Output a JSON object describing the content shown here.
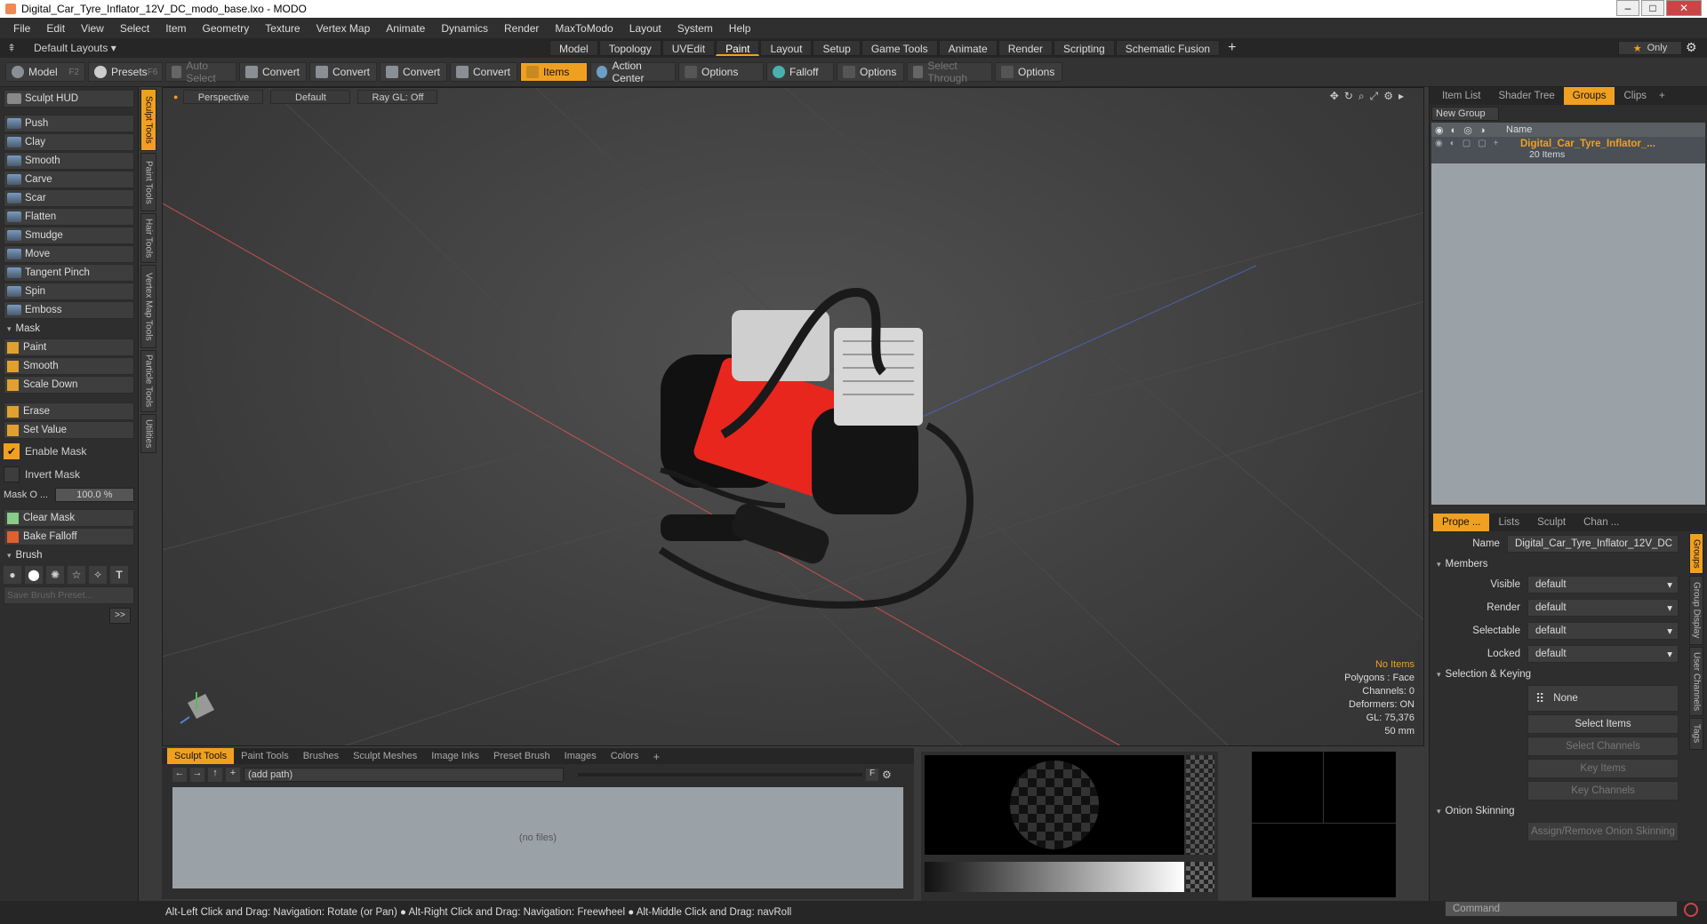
{
  "window": {
    "title": "Digital_Car_Tyre_Inflator_12V_DC_modo_base.lxo - MODO"
  },
  "menu": [
    "File",
    "Edit",
    "View",
    "Select",
    "Item",
    "Geometry",
    "Texture",
    "Vertex Map",
    "Animate",
    "Dynamics",
    "Render",
    "MaxToModo",
    "Layout",
    "System",
    "Help"
  ],
  "layoutbar": {
    "layout_select": "Default Layouts ▾",
    "tabs": [
      "Model",
      "Topology",
      "UVEdit",
      "Paint",
      "Layout",
      "Setup",
      "Game Tools",
      "Animate",
      "Render",
      "Scripting",
      "Schematic Fusion"
    ],
    "active_tab": "Paint",
    "only_label": "Only"
  },
  "toolbar": {
    "model": "Model",
    "model_key": "F2",
    "presets": "Presets",
    "presets_key": "F6",
    "auto_select": "Auto Select",
    "convert1": "Convert",
    "convert2": "Convert",
    "convert3": "Convert",
    "convert4": "Convert",
    "items": "Items",
    "action_center": "Action Center",
    "options1": "Options",
    "falloff": "Falloff",
    "options2": "Options",
    "select_through": "Select Through",
    "options3": "Options"
  },
  "left": {
    "hud": "Sculpt HUD",
    "tools": [
      "Push",
      "Clay",
      "Smooth",
      "Carve",
      "Scar",
      "Flatten",
      "Smudge",
      "Move",
      "Tangent Pinch",
      "Spin",
      "Emboss"
    ],
    "mask_section": "Mask",
    "mask_tools": [
      "Paint",
      "Smooth",
      "Scale Down"
    ],
    "erase": "Erase",
    "set_value": "Set Value",
    "enable_mask": "Enable Mask",
    "invert_mask": "Invert Mask",
    "mask_opacity_label": "Mask O ...",
    "mask_opacity": "100.0 %",
    "clear_mask": "Clear Mask",
    "bake_falloff": "Bake Falloff",
    "brush_section": "Brush",
    "save_brush": "Save Brush Preset...",
    "more": ">>"
  },
  "vtabs": [
    "Sculpt Tools",
    "Paint Tools",
    "Hair Tools",
    "Vertex Map Tools",
    "Particle Tools",
    "Utilities"
  ],
  "viewport": {
    "view": "Perspective",
    "shading": "Default",
    "raygl": "Ray GL: Off",
    "stats": {
      "items": "No Items",
      "polygons": "Polygons : Face",
      "channels": "Channels: 0",
      "deformers": "Deformers: ON",
      "gl": "GL: 75,376",
      "size": "50 mm"
    }
  },
  "bottom": {
    "tabs": [
      "Sculpt Tools",
      "Paint Tools",
      "Brushes",
      "Sculpt Meshes",
      "Image Inks",
      "Preset Brush",
      "Images",
      "Colors"
    ],
    "path": "(add path)",
    "no_files": "(no files)"
  },
  "right": {
    "top_tabs": [
      "Item List",
      "Shader Tree",
      "Groups",
      "Clips"
    ],
    "active_top": "Groups",
    "new_group": "New Group",
    "col_name": "Name",
    "group_name": "Digital_Car_Tyre_Inflator_...",
    "group_count": "20 Items",
    "prop_tabs": [
      "Prope ...",
      "Lists",
      "Sculpt",
      "Chan ..."
    ],
    "name_label": "Name",
    "name_value": "Digital_Car_Tyre_Inflator_12V_DC",
    "members": "Members",
    "visible_label": "Visible",
    "render_label": "Render",
    "selectable_label": "Selectable",
    "locked_label": "Locked",
    "default_value": "default",
    "sel_keying": "Selection & Keying",
    "none": "None",
    "select_items": "Select Items",
    "select_channels": "Select Channels",
    "key_items": "Key Items",
    "key_channels": "Key Channels",
    "onion": "Onion Skinning",
    "assign_onion": "Assign/Remove Onion Skinning",
    "side_tabs": [
      "Groups",
      "Group Display",
      "User Channels",
      "Tags"
    ]
  },
  "status": {
    "text": "Alt-Left Click and Drag: Navigation: Rotate (or Pan) ● Alt-Right Click and Drag: Navigation: Freewheel ● Alt-Middle Click and Drag: navRoll",
    "command_placeholder": "Command"
  }
}
